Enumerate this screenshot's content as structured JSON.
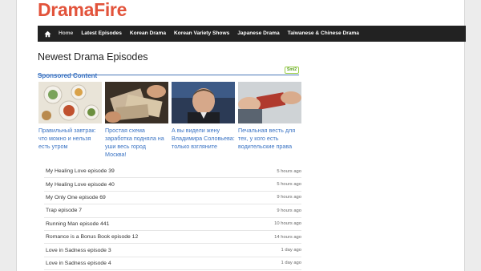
{
  "site": {
    "logo": "DramaFire"
  },
  "nav": {
    "items": [
      {
        "label": "Home",
        "active": true
      },
      {
        "label": "Latest Episodes"
      },
      {
        "label": "Korean Drama"
      },
      {
        "label": "Korean Variety Shows"
      },
      {
        "label": "Japanese Drama"
      },
      {
        "label": "Taiwanese & Chinese Drama"
      }
    ]
  },
  "main": {
    "heading": "Newest Drama Episodes",
    "sponsored": {
      "label": "Sponsored Content",
      "badge": "Smi2",
      "cards": [
        {
          "title": "Правильный завтрак: что можно и нельзя есть утром"
        },
        {
          "title": "Простая схема заработка подняла на уши весь город Москва!"
        },
        {
          "title": "А вы видели жену Владимира Соловьева: только взгляните"
        },
        {
          "title": "Печальная весть для тех, у кого есть водительские права"
        }
      ]
    },
    "episodes": [
      {
        "name": "My Healing Love episode 39",
        "time": "5 hours ago"
      },
      {
        "name": "My Healing Love episode 40",
        "time": "5 hours ago"
      },
      {
        "name": "My Only One episode 69",
        "time": "9 hours ago"
      },
      {
        "name": "Trap episode 7",
        "time": "9 hours ago"
      },
      {
        "name": "Running Man episode 441",
        "time": "10 hours ago"
      },
      {
        "name": "Romance is a Bonus Book episode 12",
        "time": "14 hours ago"
      },
      {
        "name": "Love in Sadness episode 3",
        "time": "1 day ago"
      },
      {
        "name": "Love in Sadness episode 4",
        "time": "1 day ago"
      }
    ]
  },
  "colors": {
    "logo": "#e2533b",
    "nav_bg": "#222222",
    "link": "#3b74c4"
  }
}
